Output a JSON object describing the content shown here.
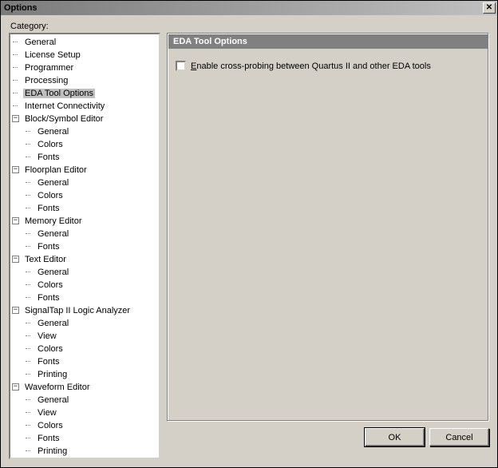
{
  "window": {
    "title": "Options"
  },
  "category_label": "Category:",
  "tree": {
    "selected": "EDA Tool Options",
    "items": [
      {
        "label": "General"
      },
      {
        "label": "License Setup"
      },
      {
        "label": "Programmer"
      },
      {
        "label": "Processing"
      },
      {
        "label": "EDA Tool Options"
      },
      {
        "label": "Internet Connectivity"
      },
      {
        "label": "Block/Symbol Editor",
        "expanded": true,
        "children": [
          {
            "label": "General"
          },
          {
            "label": "Colors"
          },
          {
            "label": "Fonts"
          }
        ]
      },
      {
        "label": "Floorplan Editor",
        "expanded": true,
        "children": [
          {
            "label": "General"
          },
          {
            "label": "Colors"
          },
          {
            "label": "Fonts"
          }
        ]
      },
      {
        "label": "Memory Editor",
        "expanded": true,
        "children": [
          {
            "label": "General"
          },
          {
            "label": "Fonts"
          }
        ]
      },
      {
        "label": "Text Editor",
        "expanded": true,
        "children": [
          {
            "label": "General"
          },
          {
            "label": "Colors"
          },
          {
            "label": "Fonts"
          }
        ]
      },
      {
        "label": "SignalTap II Logic Analyzer",
        "expanded": true,
        "children": [
          {
            "label": "General"
          },
          {
            "label": "View"
          },
          {
            "label": "Colors"
          },
          {
            "label": "Fonts"
          },
          {
            "label": "Printing"
          }
        ]
      },
      {
        "label": "Waveform Editor",
        "expanded": true,
        "children": [
          {
            "label": "General"
          },
          {
            "label": "View"
          },
          {
            "label": "Colors"
          },
          {
            "label": "Fonts"
          },
          {
            "label": "Printing"
          }
        ]
      }
    ]
  },
  "panel": {
    "title": "EDA Tool Options",
    "checkbox": {
      "checked": false,
      "label": "Enable cross-probing between Quartus II and other EDA tools",
      "accel": "E"
    }
  },
  "buttons": {
    "ok": "OK",
    "cancel": "Cancel"
  }
}
